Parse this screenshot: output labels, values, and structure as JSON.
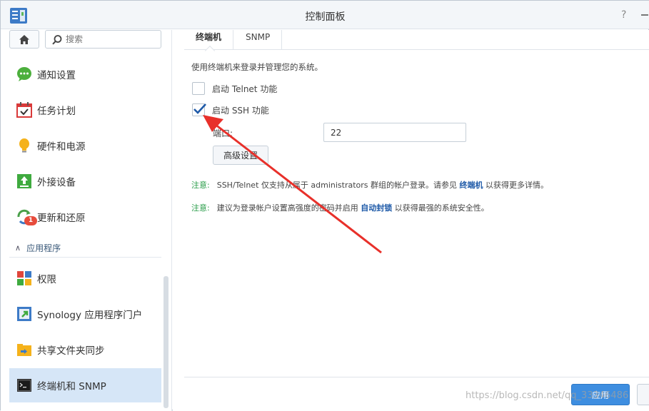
{
  "window": {
    "title": "控制面板"
  },
  "sidebar": {
    "search_placeholder": "搜索",
    "items": [
      {
        "label": "通知设置",
        "icon": "chat-bubble-icon"
      },
      {
        "label": "任务计划",
        "icon": "calendar-check-icon"
      },
      {
        "label": "硬件和电源",
        "icon": "lightbulb-icon"
      },
      {
        "label": "外接设备",
        "icon": "upload-icon"
      },
      {
        "label": "更新和还原",
        "icon": "refresh-icon",
        "badge": "1"
      }
    ],
    "section": "应用程序",
    "apps": [
      {
        "label": "权限",
        "icon": "grid-icon"
      },
      {
        "label": "Synology 应用程序门户",
        "icon": "portal-icon"
      },
      {
        "label": "共享文件夹同步",
        "icon": "folder-sync-icon"
      },
      {
        "label": "终端机和 SNMP",
        "icon": "terminal-icon",
        "active": true
      }
    ]
  },
  "tabs": [
    {
      "label": "终端机",
      "active": true
    },
    {
      "label": "SNMP",
      "active": false
    }
  ],
  "terminal": {
    "description": "使用终端机来登录并管理您的系统。",
    "telnet_label": "启动 Telnet 功能",
    "telnet_checked": false,
    "ssh_label": "启动 SSH 功能",
    "ssh_checked": true,
    "port_label": "端口:",
    "port_value": "22",
    "advanced_label": "高级设置",
    "note1": {
      "label": "注意:",
      "text_before": "SSH/Telnet 仅支持从属于 administrators 群组的帐户登录。请参见 ",
      "link": "终端机",
      "text_after": " 以获得更多详情。"
    },
    "note2": {
      "label": "注意:",
      "text_before": "建议为登录帐户设置高强度的密码并启用 ",
      "link": "自动封锁",
      "text_after": " 以获得最强的系统安全性。"
    }
  },
  "footer": {
    "apply_label": "应用"
  },
  "watermark": "https://blog.csdn.net/qq_33346486",
  "colors": {
    "accent": "#3e8ee0",
    "active_item": "#d6e6f7",
    "note_label": "#2a9d4a",
    "arrow": "#e8302a"
  }
}
